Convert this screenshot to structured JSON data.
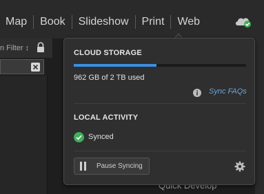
{
  "nav": {
    "modules": [
      "Map",
      "Book",
      "Slideshow",
      "Print",
      "Web"
    ]
  },
  "filter": {
    "label": "n Filter ↕"
  },
  "panel": {
    "quick_develop": "Quick Develop"
  },
  "cloud_popover": {
    "storage_title": "CLOUD STORAGE",
    "storage_used_fraction": 0.481,
    "storage_used_text": "962 GB of 2 TB used",
    "sync_faqs_label": "Sync FAQs",
    "activity_title": "LOCAL ACTIVITY",
    "status_text": "Synced",
    "pause_button_label": "Pause Syncing"
  },
  "icons": {
    "cloud": "cloud-sync-icon",
    "info": "info-icon",
    "check": "check-circle-icon",
    "pause": "pause-icon",
    "gear": "gear-icon",
    "lock": "lock-icon",
    "close": "close-icon"
  },
  "colors": {
    "accent": "#3d8ee0",
    "link": "#6fa4d8",
    "success": "#3fae5a"
  }
}
